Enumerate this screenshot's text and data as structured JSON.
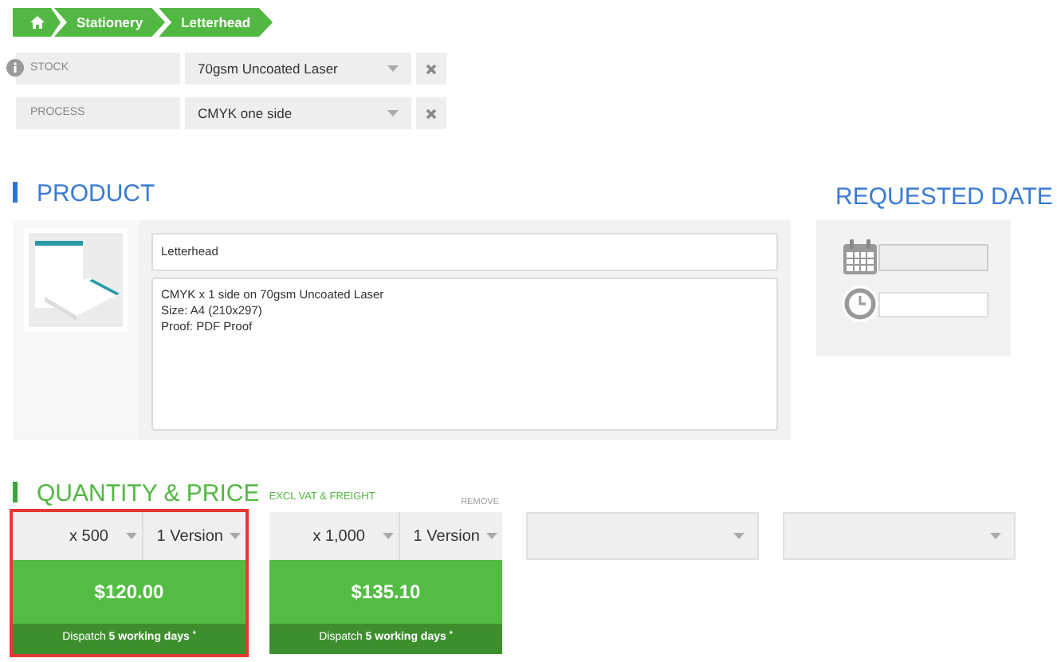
{
  "breadcrumb": [
    {
      "kind": "home"
    },
    {
      "kind": "text",
      "label": "Stationery"
    },
    {
      "kind": "text",
      "label": "Letterhead"
    }
  ],
  "options": [
    {
      "label": "STOCK",
      "value": "70gsm Uncoated Laser",
      "info": true
    },
    {
      "label": "PROCESS",
      "value": "CMYK one side",
      "info": false
    }
  ],
  "product": {
    "heading": "PRODUCT",
    "name": "Letterhead",
    "description": "CMYK x 1 side on 70gsm Uncoated Laser\nSize: A4 (210x297)\nProof: PDF Proof"
  },
  "requested_date": {
    "heading": "REQUESTED DATE"
  },
  "quantity": {
    "heading": "QUANTITY & PRICE",
    "note": "EXCL VAT & FREIGHT",
    "remove": "REMOVE",
    "cards": [
      {
        "kind": "priced",
        "selected": true,
        "qty": "x 500",
        "versions": "1 Version",
        "price": "$120.00",
        "dispatch": "Dispatch **5 working days $^{*}$**"
      },
      {
        "kind": "priced",
        "selected": false,
        "qty": "x 1,000",
        "versions": "1 Version",
        "price": "$135.10",
        "dispatch": "Dispatch **5 working days $^{*}$**"
      },
      {
        "kind": "empty",
        "selected": false
      },
      {
        "kind": "empty",
        "selected": false
      }
    ]
  }
}
